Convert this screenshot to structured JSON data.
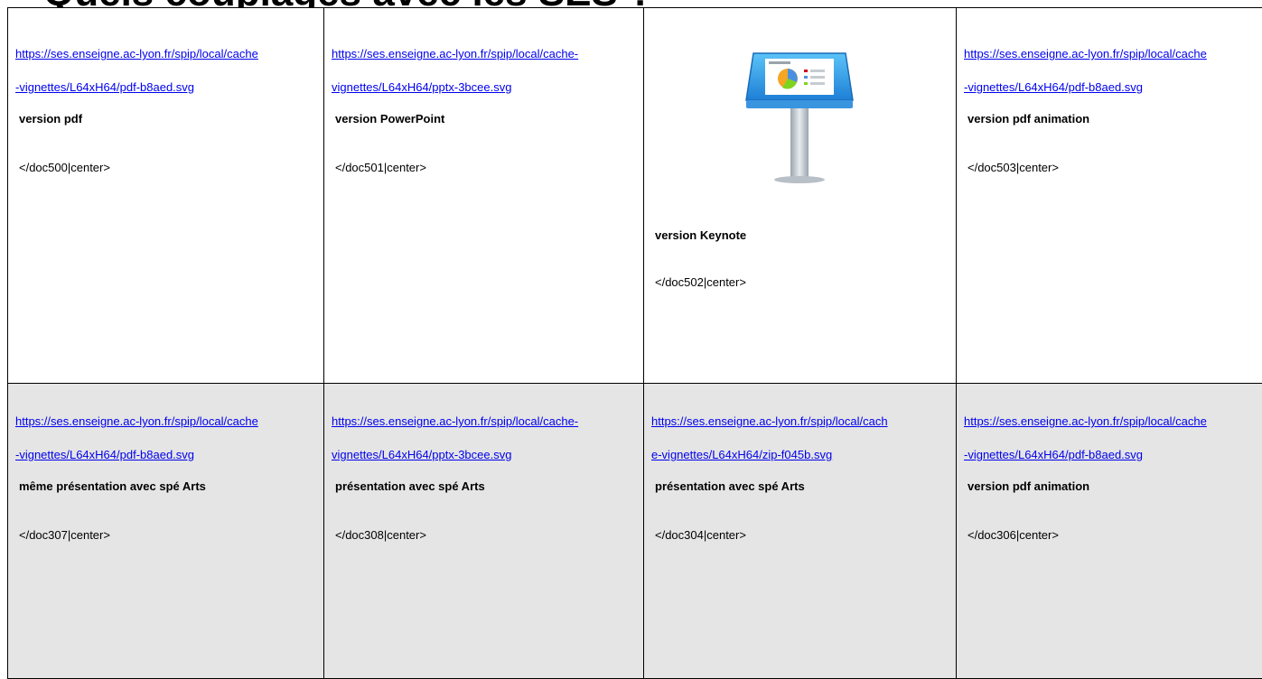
{
  "page": {
    "heading": "Quels couplages avec les SES ?"
  },
  "colors": {
    "link": "#0000ee",
    "row_bottom_background": "#e5e5e5",
    "border": "#000000"
  },
  "rows": [
    {
      "cells": [
        {
          "link_line1": "https://ses.enseigne.ac-lyon.fr/spip/local/cache",
          "link_line2": "-vignettes/L64xH64/pdf-b8aed.svg",
          "label": "version pdf",
          "code": "</doc500|center>"
        },
        {
          "link_line1": "https://ses.enseigne.ac-lyon.fr/spip/local/cache-",
          "link_line2": "vignettes/L64xH64/pptx-3bcee.svg",
          "label": "version PowerPoint",
          "code": "</doc501|center>"
        },
        {
          "icon": "keynote-icon",
          "label": "version Keynote",
          "code": "</doc502|center>"
        },
        {
          "link_line1": "https://ses.enseigne.ac-lyon.fr/spip/local/cache",
          "link_line2": "-vignettes/L64xH64/pdf-b8aed.svg",
          "label": "version pdf animation",
          "code": "</doc503|center>"
        }
      ]
    },
    {
      "cells": [
        {
          "link_line1": "https://ses.enseigne.ac-lyon.fr/spip/local/cache",
          "link_line2": "-vignettes/L64xH64/pdf-b8aed.svg",
          "label": "même présentation avec spé Arts",
          "code": "</doc307|center>"
        },
        {
          "link_line1": "https://ses.enseigne.ac-lyon.fr/spip/local/cache-",
          "link_line2": "vignettes/L64xH64/pptx-3bcee.svg",
          "label": "présentation avec spé Arts",
          "code": "</doc308|center>"
        },
        {
          "link_line1": "https://ses.enseigne.ac-lyon.fr/spip/local/cach",
          "link_line2": "e-vignettes/L64xH64/zip-f045b.svg",
          "label": "présentation avec spé Arts",
          "code": "</doc304|center>"
        },
        {
          "link_line1": "https://ses.enseigne.ac-lyon.fr/spip/local/cache",
          "link_line2": "-vignettes/L64xH64/pdf-b8aed.svg",
          "label": "version pdf animation",
          "code": "</doc306|center>"
        }
      ]
    }
  ]
}
